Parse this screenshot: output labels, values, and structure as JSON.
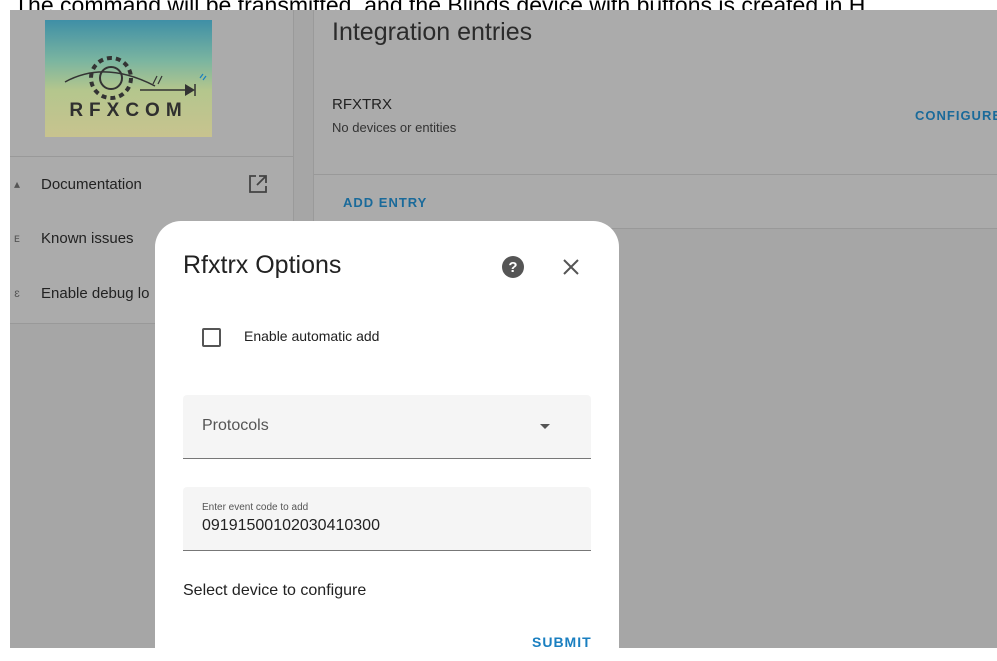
{
  "caption": "The command will be transmitted, and the Blinds device with buttons is created in H",
  "sidebar": {
    "logo_text": "RFXCOM",
    "items": [
      {
        "label": "Documentation",
        "icon": "book-icon"
      },
      {
        "label": "Known issues",
        "icon": "bug-icon"
      },
      {
        "label": "Enable debug lo",
        "icon": "debug-icon"
      }
    ],
    "external_link_icon": "open-in-new-icon"
  },
  "integration": {
    "title": "Integration entries",
    "entry_name": "RFXTRX",
    "entry_sub": "No devices or entities",
    "configure_label": "CONFIGURE",
    "add_entry_label": "ADD ENTRY"
  },
  "dialog": {
    "title": "Rfxtrx Options",
    "help_icon": "help-circle-icon",
    "close_icon": "close-icon",
    "automatic_add_label": "Enable automatic add",
    "automatic_add_checked": false,
    "protocols_label": "Protocols",
    "event_code_label": "Enter event code to add",
    "event_code_value": "09191500102030410300",
    "select_device_label": "Select device to configure",
    "submit_label": "SUBMIT"
  },
  "colors": {
    "overlay": "#a6a6a6",
    "accent": "#1a7fc0",
    "dialog_bg": "#ffffff",
    "field_bg": "#f5f5f5"
  }
}
